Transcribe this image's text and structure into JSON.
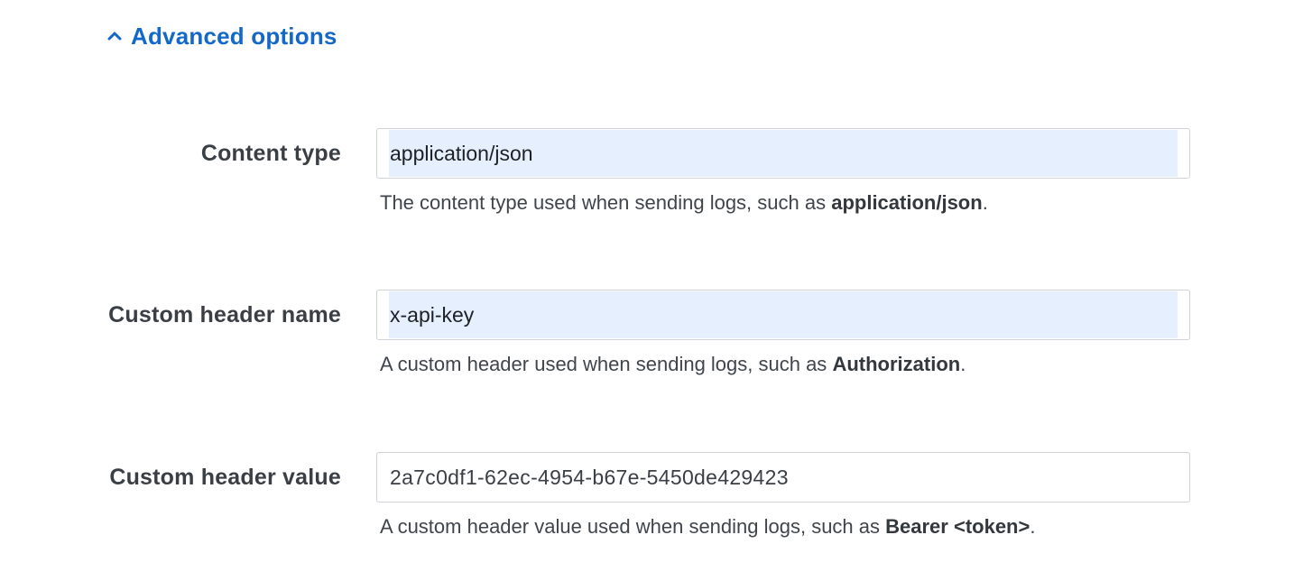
{
  "advanced_toggle": {
    "label": "Advanced options",
    "expanded": true,
    "icon": "chevron-up-icon",
    "color": "#1468c8"
  },
  "fields": {
    "content_type": {
      "label": "Content type",
      "value": "application/json",
      "help_prefix": "The content type used when sending logs, such as ",
      "help_example": "application/json",
      "help_suffix": "."
    },
    "custom_header_name": {
      "label": "Custom header name",
      "value": "x-api-key",
      "help_prefix": "A custom header used when sending logs, such as ",
      "help_example": "Authorization",
      "help_suffix": "."
    },
    "custom_header_value": {
      "label": "Custom header value",
      "value": "2a7c0df1-62ec-4954-b67e-5450de429423",
      "help_prefix": "A custom header value used when sending logs, such as ",
      "help_example": "Bearer <token>",
      "help_suffix": "."
    }
  },
  "colors": {
    "autofill_background": "#e6effd",
    "input_border": "#cfd3d8",
    "label_text": "#3a3f45"
  }
}
